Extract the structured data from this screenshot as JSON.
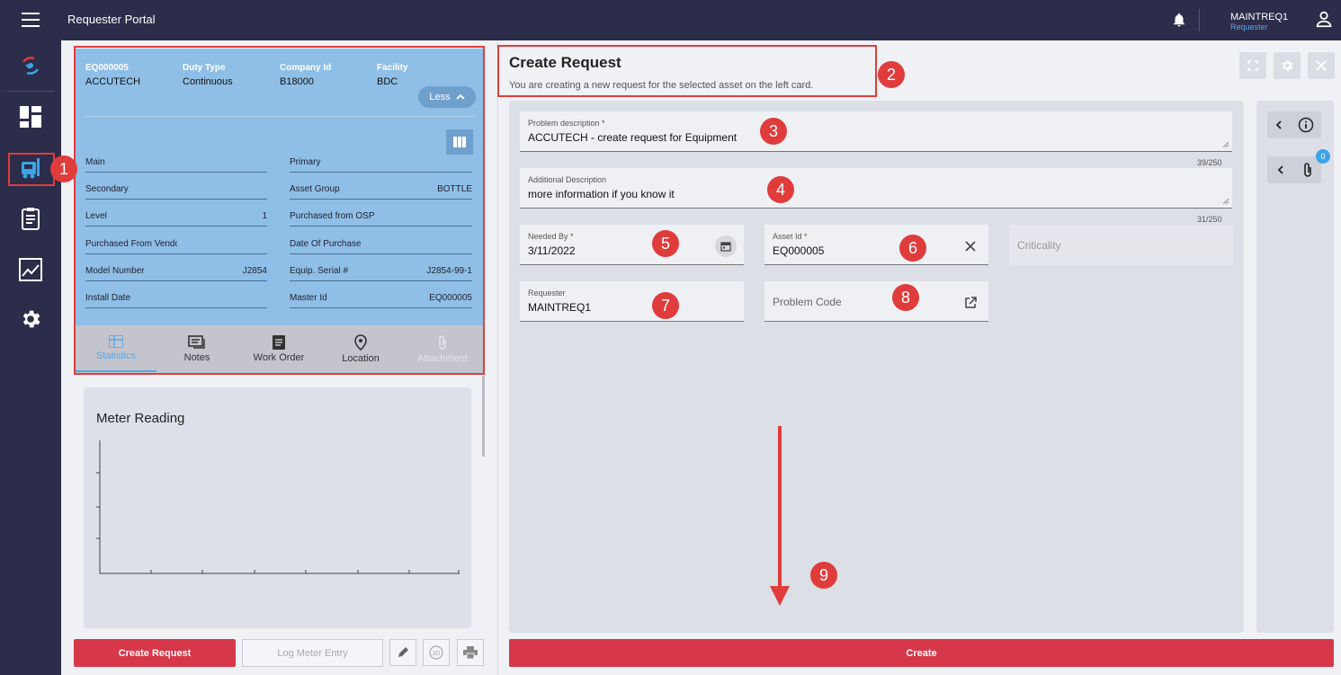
{
  "topbar": {
    "title": "Requester Portal",
    "user_name": "MAINTREQ1",
    "user_role": "Requester"
  },
  "nav": {
    "items": [
      "logo-icon",
      "dashboard-icon",
      "equipment-icon",
      "clipboard-icon",
      "analytics-icon",
      "settings-icon"
    ]
  },
  "asset_card": {
    "headers": [
      {
        "label": "EQ000005",
        "value": "ACCUTECH"
      },
      {
        "label": "Duty Type",
        "value": "Continuous"
      },
      {
        "label": "Company Id",
        "value": "B18000"
      },
      {
        "label": "Facility",
        "value": "BDC"
      }
    ],
    "less_label": "Less",
    "fields_left": [
      {
        "label": "Main",
        "value": ""
      },
      {
        "label": "Secondary",
        "value": ""
      },
      {
        "label": "Level",
        "value": "1"
      },
      {
        "label": "Purchased From Vendo",
        "value": ""
      },
      {
        "label": "Model Number",
        "value": "J2854"
      },
      {
        "label": "Install Date",
        "value": ""
      }
    ],
    "fields_right": [
      {
        "label": "Primary",
        "value": ""
      },
      {
        "label": "Asset Group",
        "value": "BOTTLE"
      },
      {
        "label": "Purchased from OSP",
        "value": ""
      },
      {
        "label": "Date Of Purchase",
        "value": ""
      },
      {
        "label": "Equip. Serial #",
        "value": "J2854-99-1"
      },
      {
        "label": "Master Id",
        "value": "EQ000005"
      }
    ],
    "tabs": [
      "Statistics",
      "Notes",
      "Work Order",
      "Location",
      "Attachment"
    ]
  },
  "meter": {
    "title": "Meter Reading"
  },
  "left_actions": {
    "create_request": "Create Request",
    "log_meter": "Log Meter Entry"
  },
  "form": {
    "title": "Create Request",
    "subtitle": "You are creating a new request for the selected asset on the left card.",
    "problem_description": {
      "label": "Problem description *",
      "value": "ACCUTECH - create request for Equipment",
      "counter": "39/250"
    },
    "additional_description": {
      "label": "Additional Description",
      "value": "more information if you know it",
      "counter": "31/250"
    },
    "needed_by": {
      "label": "Needed By *",
      "value": "3/11/2022"
    },
    "asset_id": {
      "label": "Asset Id *",
      "value": "EQ000005"
    },
    "criticality": {
      "placeholder": "Criticality"
    },
    "requester": {
      "label": "Requester",
      "value": "MAINTREQ1"
    },
    "problem_code": {
      "placeholder": "Problem Code"
    },
    "attachment_count": "0",
    "create_label": "Create"
  },
  "annotations": [
    "1",
    "2",
    "3",
    "4",
    "5",
    "6",
    "7",
    "8",
    "9"
  ],
  "colors": {
    "nav_bg": "#2b2d4a",
    "card_bg": "#8fbfe6",
    "accent_red": "#d6374a",
    "annotation_red": "#e03c3c",
    "link_blue": "#5aa7e6"
  }
}
